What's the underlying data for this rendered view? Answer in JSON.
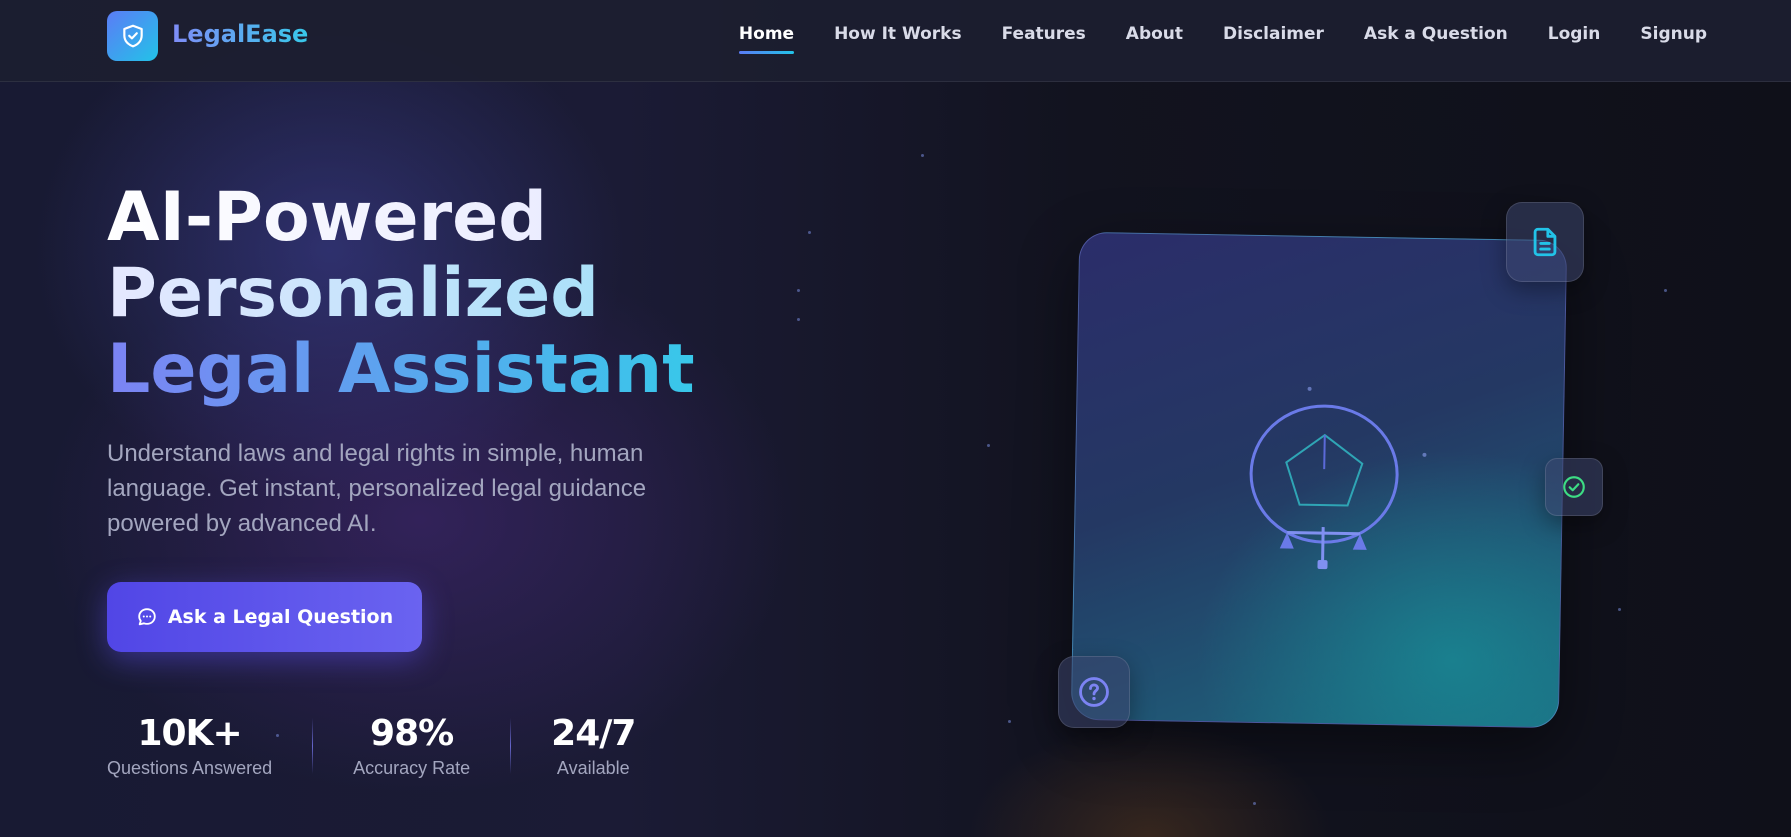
{
  "brand": {
    "name": "LegalEase",
    "logo_icon": "shield-check-icon"
  },
  "nav": {
    "items": [
      {
        "label": "Home",
        "active": true
      },
      {
        "label": "How It Works",
        "active": false
      },
      {
        "label": "Features",
        "active": false
      },
      {
        "label": "About",
        "active": false
      },
      {
        "label": "Disclaimer",
        "active": false
      },
      {
        "label": "Ask a Question",
        "active": false
      },
      {
        "label": "Login",
        "active": false
      },
      {
        "label": "Signup",
        "active": false
      }
    ]
  },
  "hero": {
    "title_line1": "AI-Powered",
    "title_line2": "Personalized",
    "title_line3": "Legal Assistant",
    "subtitle": "Understand laws and legal rights in simple, human language. Get instant, personalized legal guidance powered by advanced AI.",
    "cta_label": "Ask a Legal Question",
    "cta_icon": "chat-bubble-icon"
  },
  "stats": [
    {
      "value": "10K+",
      "label": "Questions Answered"
    },
    {
      "value": "98%",
      "label": "Accuracy Rate"
    },
    {
      "value": "24/7",
      "label": "Available"
    }
  ],
  "illustration": {
    "center_icon": "scales-of-justice-icon",
    "badges": [
      "document-icon",
      "check-circle-icon",
      "question-circle-icon"
    ]
  },
  "colors": {
    "accent": "#5b7cf6",
    "accent_secondary": "#22c3e8",
    "cta": "#5146e6",
    "success": "#3ddc84",
    "background": "#12131f"
  }
}
